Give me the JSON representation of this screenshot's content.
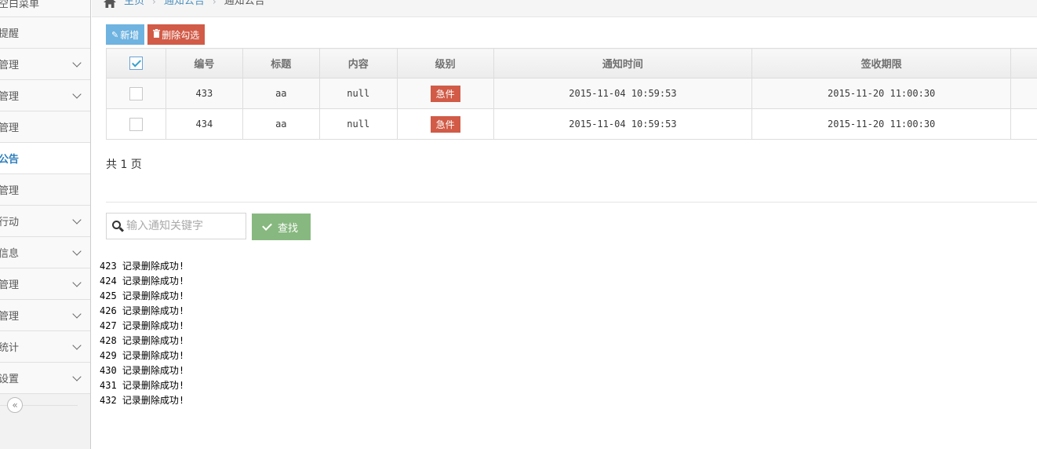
{
  "sidebar": {
    "items": [
      {
        "label": "空白菜单",
        "expandable": false
      },
      {
        "label": "提醒",
        "expandable": false
      },
      {
        "label": "管理",
        "expandable": true
      },
      {
        "label": "管理",
        "expandable": true
      },
      {
        "label": "管理",
        "expandable": false
      },
      {
        "label": "公告",
        "expandable": false,
        "active": true
      },
      {
        "label": "管理",
        "expandable": false
      },
      {
        "label": "行动",
        "expandable": true
      },
      {
        "label": "信息",
        "expandable": true
      },
      {
        "label": "管理",
        "expandable": true
      },
      {
        "label": "管理",
        "expandable": true
      },
      {
        "label": "统计",
        "expandable": true
      },
      {
        "label": "设置",
        "expandable": true
      }
    ],
    "collapse_glyph": "«"
  },
  "breadcrumb": {
    "home": "主页",
    "section": "通知公告",
    "current": "通知公告"
  },
  "toolbar": {
    "add_label": "新增",
    "delete_label": "删除勾选"
  },
  "table": {
    "headers": [
      "编号",
      "标题",
      "内容",
      "级别",
      "通知时间",
      "签收期限"
    ],
    "rows": [
      {
        "id": "433",
        "title": "aa",
        "content": "null",
        "level": "急件",
        "notify_time": "2015-11-04 10:59:53",
        "deadline": "2015-11-20 11:00:30"
      },
      {
        "id": "434",
        "title": "aa",
        "content": "null",
        "level": "急件",
        "notify_time": "2015-11-04 10:59:53",
        "deadline": "2015-11-20 11:00:30"
      }
    ]
  },
  "pagination": {
    "text": "共 1 页"
  },
  "search": {
    "placeholder": "输入通知关键字",
    "button_label": "查找"
  },
  "log": [
    "423 记录删除成功!",
    "424 记录删除成功!",
    "425 记录删除成功!",
    "426 记录删除成功!",
    "427 记录删除成功!",
    "428 记录删除成功!",
    "429 记录删除成功!",
    "430 记录删除成功!",
    "431 记录删除成功!",
    "432 记录删除成功!"
  ],
  "colors": {
    "accent": "#2b7dbc",
    "danger": "#d15b47",
    "info": "#6fb3e0",
    "success": "#87b87f"
  }
}
